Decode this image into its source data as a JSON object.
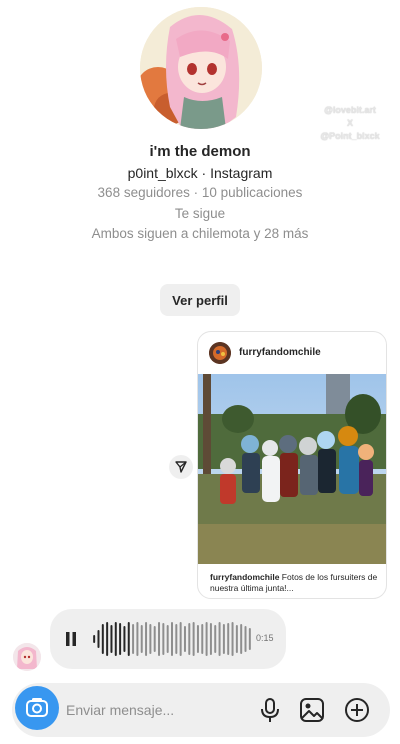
{
  "profile": {
    "display_name": "i'm the demon",
    "username_line": "p0int_blxck · Instagram",
    "stats": "368 seguidores · 10 publicaciones",
    "follows_you": "Te sigue",
    "mutual": "Ambos siguen a chilemota y 28 más",
    "view_profile_label": "Ver perfil"
  },
  "watermark": {
    "line1": "@lovebit.art",
    "line2": "X",
    "line3": "@Point_blxck"
  },
  "shared_post": {
    "account": "furryfandomchile",
    "caption_user": "furryfandomchile",
    "caption_text": " Fotos de los fursuiters de nuestra última junta!..."
  },
  "voice_message": {
    "duration": "0:15"
  },
  "composer": {
    "placeholder": "Enviar mensaje..."
  },
  "icons": {
    "camera": "camera-icon",
    "mic": "microphone-icon",
    "gallery": "gallery-icon",
    "plus": "plus-circle-icon",
    "share": "share-icon",
    "pause": "pause-icon"
  },
  "colors": {
    "accent": "#3897f0",
    "bubble": "#efefef",
    "secondary_text": "#8e8e8e"
  }
}
